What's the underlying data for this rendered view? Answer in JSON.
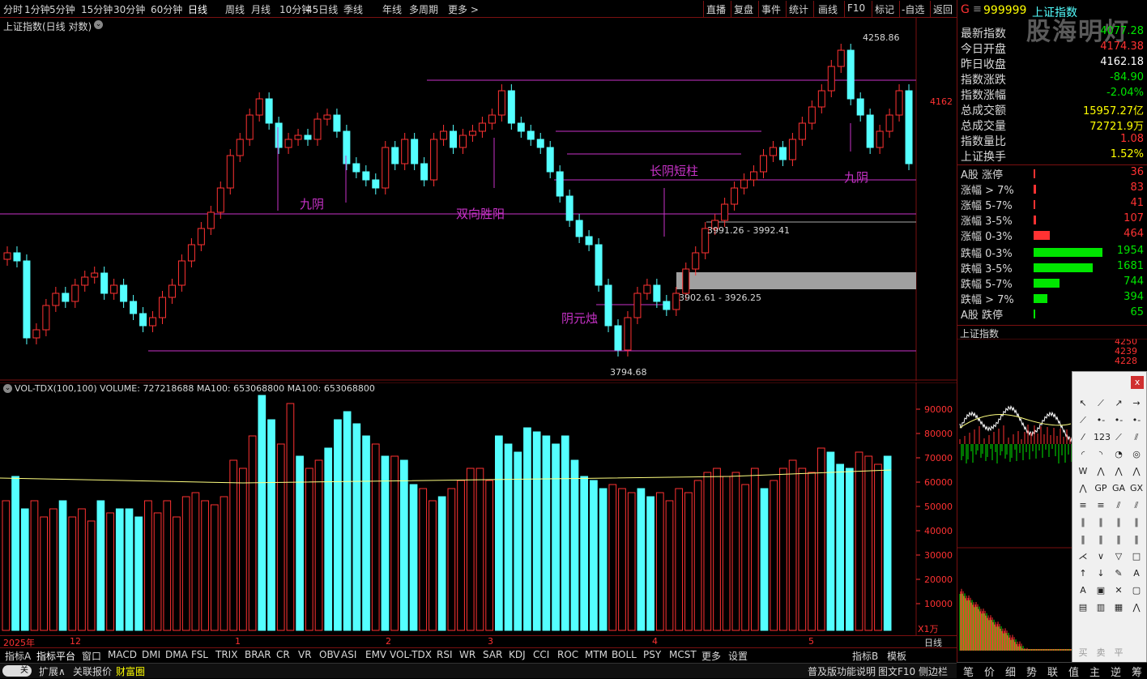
{
  "toolbar": {
    "periods": [
      "分时",
      "1分钟",
      "5分钟",
      "15分钟",
      "30分钟",
      "60分钟",
      "日线",
      "周线",
      "月线",
      "10分钟",
      "45日线",
      "季线",
      "年线",
      "多周期",
      "更多 >"
    ],
    "active": "日线",
    "right_buttons": [
      "直播",
      "复盘",
      "事件",
      "统计",
      "画线",
      "F10",
      "标记",
      "-自选",
      "返回"
    ]
  },
  "main_title": "上证指数(日线 对数)",
  "annotations": {
    "high": "4258.86",
    "low": "3794.68",
    "price_label": "4162",
    "range1": "3991.26 - 3992.41",
    "range2": "3902.61 - 3926.25",
    "t_jiuyin1": "九阴",
    "t_shuangxiang": "双向胜阳",
    "t_changyin": "长阴短柱",
    "t_yinyuan": "阴元烛",
    "t_jiuyin2": "九阴"
  },
  "vol_title": "VOL-TDX(100,100)  VOLUME: 727218688  MA100: 653068800  MA100: 653068800",
  "vol_axis": [
    "90000",
    "80000",
    "70000",
    "60000",
    "50000",
    "40000",
    "30000",
    "20000",
    "10000"
  ],
  "vol_unit": "X1万",
  "x_axis": [
    "2025年",
    "12",
    "1",
    "2",
    "3",
    "4",
    "5"
  ],
  "x_axis_right": "日线",
  "tabs": [
    "指标A",
    "指标平台",
    "窗口",
    "MACD",
    "DMI",
    "DMA",
    "FSL",
    "TRIX",
    "BRAR",
    "CR",
    "VR",
    "OBV",
    "ASI",
    "EMV",
    "VOL-TDX",
    "RSI",
    "WR",
    "SAR",
    "KDJ",
    "CCI",
    "ROC",
    "MTM",
    "BOLL",
    "PSY",
    "MCST",
    "更多",
    "设置",
    "指标B",
    "模板"
  ],
  "status": {
    "toggle": "关",
    "items": [
      "扩展∧",
      "关联报价",
      "财富圈"
    ],
    "right": [
      "普及版功能说明",
      "图文F10",
      "侧边栏"
    ]
  },
  "quote": {
    "code": "999999",
    "name": "上证指数",
    "watermark": "股海明灯",
    "rows": [
      {
        "label": "最新指数",
        "value": "4077.28",
        "color": "#00e600"
      },
      {
        "label": "今日开盘",
        "value": "4174.38",
        "color": "#ff3232"
      },
      {
        "label": "昨日收盘",
        "value": "4162.18",
        "color": "#ffffff"
      },
      {
        "label": "指数涨跌",
        "value": "-84.90",
        "color": "#00e600"
      },
      {
        "label": "指数涨幅",
        "value": "-2.04%",
        "color": "#00e600"
      },
      {
        "label": "总成交额",
        "value": "15957.27亿",
        "color": "#ffff00"
      },
      {
        "label": "总成交量",
        "value": "72721.9万",
        "color": "#ffff00"
      },
      {
        "label": "指数量比",
        "value": "1.08",
        "color": "#ff3232"
      },
      {
        "label": "上证换手",
        "value": "1.52%",
        "color": "#ffff00"
      }
    ],
    "breadth_up": [
      {
        "label": "A股 涨停",
        "value": "36",
        "pct": 0.01
      },
      {
        "label": "涨幅 > 7%",
        "value": "83",
        "pct": 0.03
      },
      {
        "label": "涨幅 5-7%",
        "value": "41",
        "pct": 0.01
      },
      {
        "label": "涨幅 3-5%",
        "value": "107",
        "pct": 0.04
      },
      {
        "label": "涨幅 0-3%",
        "value": "464",
        "pct": 0.24
      }
    ],
    "breadth_down": [
      {
        "label": "跌幅 0-3%",
        "value": "1954",
        "pct": 1.0
      },
      {
        "label": "跌幅 3-5%",
        "value": "1681",
        "pct": 0.86
      },
      {
        "label": "跌幅 5-7%",
        "value": "744",
        "pct": 0.38
      },
      {
        "label": "跌幅 > 7%",
        "value": "394",
        "pct": 0.2
      },
      {
        "label": "A股 跌停",
        "value": "65",
        "pct": 0.02
      }
    ],
    "mini_title": "上证指数",
    "mini_ticks": [
      "4250",
      "4239",
      "4228"
    ],
    "footer": [
      "笔",
      "价",
      "细",
      "势",
      "联",
      "值",
      "主",
      "逆",
      "筹"
    ]
  },
  "palette_close": "x",
  "palette_bottom": [
    "买",
    "卖",
    "平"
  ],
  "colors": {
    "up": "#ff3232",
    "down": "#54ffff",
    "line": "#c832c8",
    "ma": "#ffff80"
  }
}
